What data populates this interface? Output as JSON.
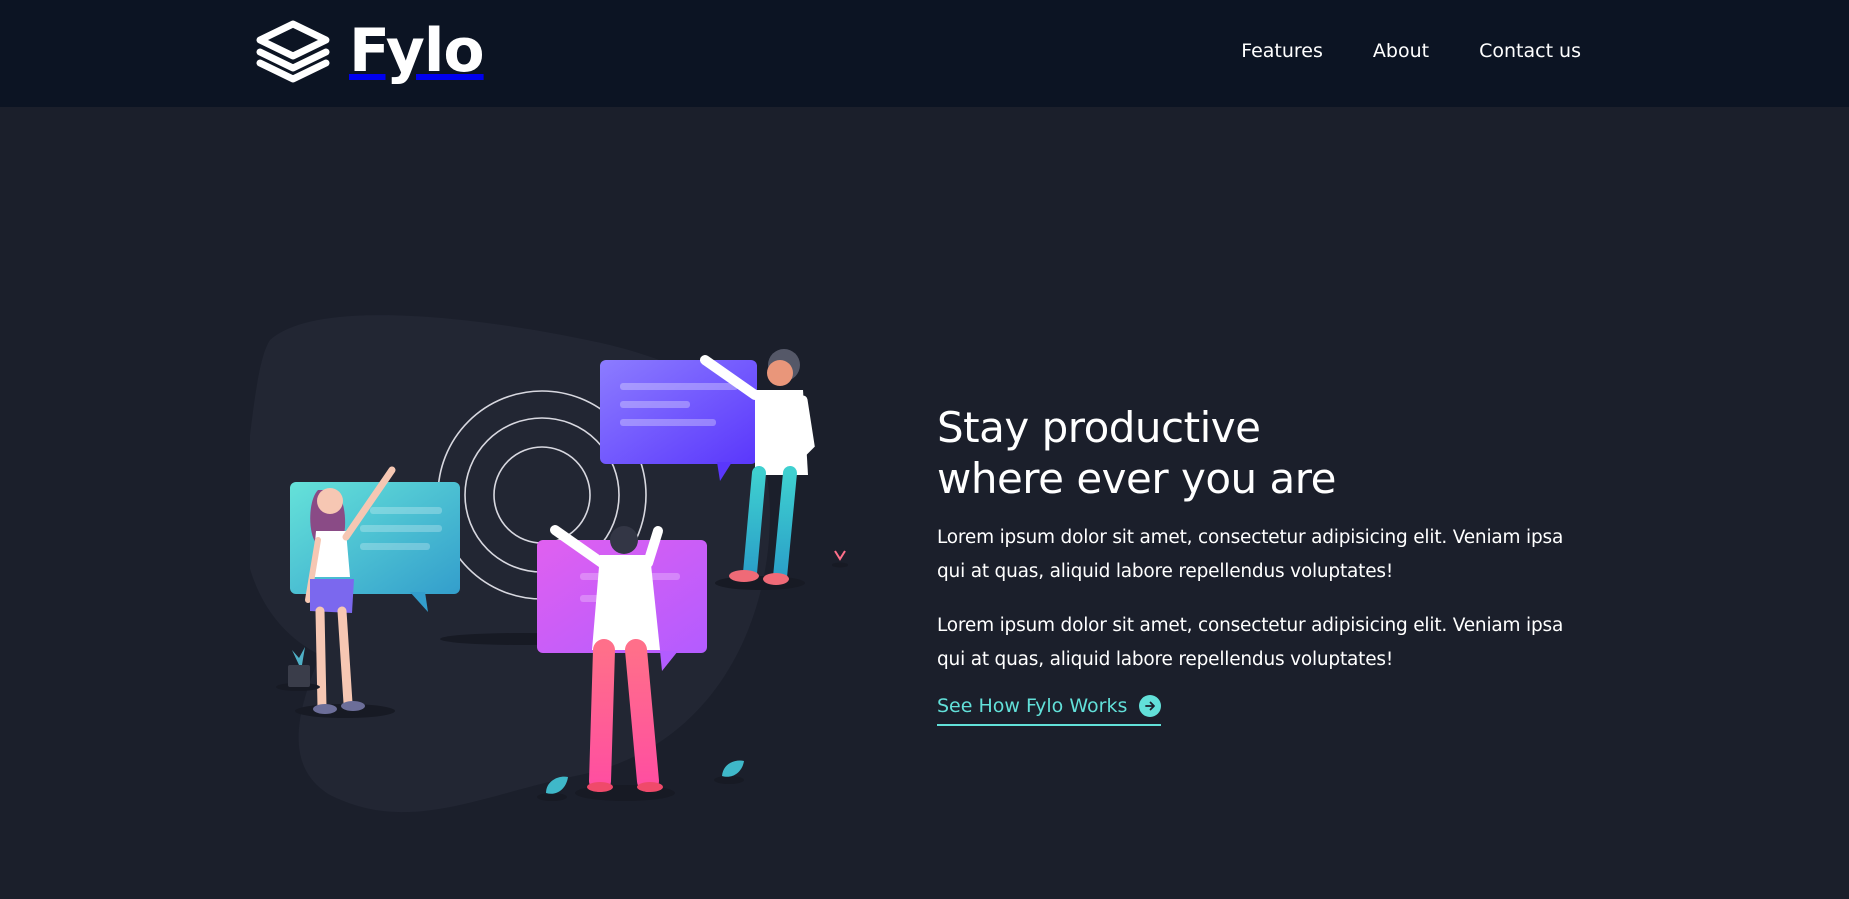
{
  "brand": {
    "name": "Fylo",
    "icon": "layers-icon"
  },
  "nav": {
    "items": [
      "Features",
      "About",
      "Contact us"
    ]
  },
  "hero": {
    "title_line1": "Stay productive",
    "title_line2": "where ever you are",
    "paragraph1": "Lorem ipsum dolor sit amet, consectetur adipisicing elit. Veniam ipsa qui at quas, aliquid labore repellendus voluptates!",
    "paragraph2": "Lorem ipsum dolor sit amet, consectetur adipisicing elit. Veniam ipsa qui at quas, aliquid labore repellendus voluptates!",
    "cta_label": "See How Fylo Works",
    "cta_icon": "arrow-right-circle-icon"
  },
  "colors": {
    "header_bg": "#0c1423",
    "page_bg": "#1b1f2b",
    "accent": "#62e0d9",
    "text": "#ffffff"
  }
}
